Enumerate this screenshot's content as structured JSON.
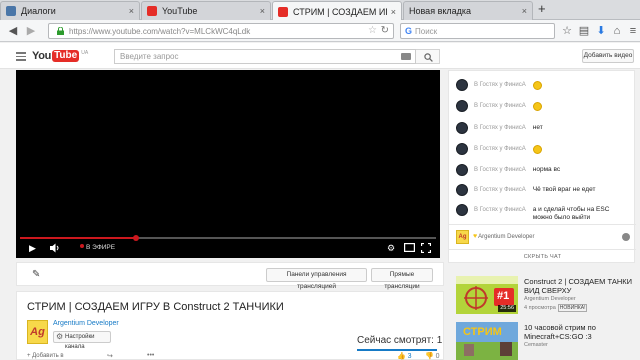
{
  "browser": {
    "tabs": [
      {
        "label": "Диалоги",
        "icon": "vk-dialogs-icon",
        "color": "#4a76a8"
      },
      {
        "label": "YouTube",
        "icon": "youtube-icon",
        "color": "#e52d27"
      },
      {
        "label": "СТРИМ | СОЗДАЕМ ИГРУ В CONSTRUC...",
        "icon": "youtube-icon",
        "color": "#e52d27"
      },
      {
        "label": "Новая вкладка",
        "icon": "",
        "color": ""
      }
    ],
    "new_tab": "+",
    "close_glyph": "×",
    "url": "https://www.youtube.com/watch?v=MLCkWC4qLdk",
    "search_placeholder": "Поиск"
  },
  "youtube": {
    "logo_you": "You",
    "logo_tube": "Tube",
    "logo_region": "UA",
    "search_placeholder": "Введите запрос",
    "add_video": "Добавить видео",
    "live_label": "В ЭФИРЕ",
    "live_progress": 0.28,
    "buttons": {
      "stream_dashboard": "Панели управления трансляцией",
      "live_streams": "Прямые трансляции"
    },
    "video": {
      "title": "СТРИМ | СОЗДАЕМ ИГРУ В Construct 2 ТАНЧИКИ",
      "channel_initials": "Ag",
      "channel_name": "Argentium Developer",
      "channel_settings": "Настройки канала",
      "viewers": "Сейчас смотрят: 1",
      "add_to": "Добавить в",
      "likes": "3",
      "dislikes": "0"
    },
    "chat": {
      "messages": [
        {
          "author": "В Гостях у ФинисА",
          "text": "",
          "emoji": true
        },
        {
          "author": "В Гостях у ФинисА",
          "text": "",
          "emoji": true
        },
        {
          "author": "В Гостях у ФинисА",
          "text": "нет",
          "emoji": false
        },
        {
          "author": "В Гостях у ФинисА",
          "text": "",
          "emoji": true
        },
        {
          "author": "В Гостях у ФинисА",
          "text": "норма вс",
          "emoji": false
        },
        {
          "author": "В Гостях у ФинисА",
          "text": "Чё твой враг не едет",
          "emoji": false
        },
        {
          "author": "В Гостях у ФинисА",
          "text": "а и сделай чтобы на ESC можно было выйти",
          "emoji": false
        }
      ],
      "self_name": "Argentium Developer",
      "hide_chat": "СКРЫТЬ ЧАТ"
    },
    "related": [
      {
        "title": "Construct 2 | СОЗДАЕМ ТАНКИ ВИД СВЕРХУ",
        "channel": "Argentium Developer",
        "views": "4 просмотра",
        "badge": "НОВИНКА!",
        "duration": "25:56",
        "thumb_text": "#1"
      },
      {
        "title": "10 часовой стрим по Minecraft+CS:GO :3",
        "channel": "Cemaster",
        "views": "",
        "badge": "",
        "duration": "",
        "thumb_text": "СТРИМ"
      }
    ]
  },
  "colors": {
    "accent_red": "#e52d27",
    "link_blue": "#167ac6"
  }
}
